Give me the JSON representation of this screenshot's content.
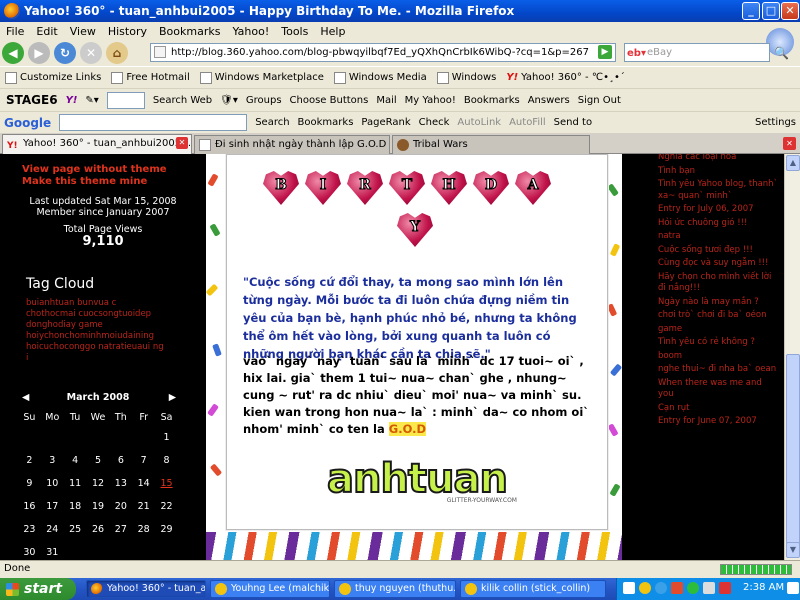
{
  "window": {
    "title": "Yahoo! 360° - tuan_anhbui2005 - Happy Birthday To Me. - Mozilla Firefox"
  },
  "menu": [
    "File",
    "Edit",
    "View",
    "History",
    "Bookmarks",
    "Yahoo!",
    "Tools",
    "Help"
  ],
  "nav": {
    "url": "http://blog.360.yahoo.com/blog-pbwqyilbqf7Ed_yQXhQnCrbIk6WibQ-?cq=1&p=267",
    "search_engine": "eBay",
    "search_placeholder": "eBay"
  },
  "bookmarks_bar": [
    "Customize Links",
    "Free Hotmail",
    "Windows Marketplace",
    "Windows Media",
    "Windows",
    "Yahoo! 360° - ℃•¸•´"
  ],
  "yahoo_toolbar": {
    "stage": "STAGE6",
    "logo": "Y!",
    "items": [
      "Search Web",
      "Groups",
      "Choose Buttons",
      "Mail",
      "My Yahoo!",
      "Bookmarks",
      "Answers",
      "Sign Out"
    ]
  },
  "google_toolbar": {
    "logo": "Google",
    "items": [
      "Search",
      "Bookmarks",
      "PageRank",
      "Check",
      "AutoLink",
      "AutoFill",
      "Send to",
      "Settings"
    ]
  },
  "tabs": [
    {
      "label": "Yahoo! 360° - tuan_anhbui2005 -..."
    },
    {
      "label": "Đi sinh nhật ngày thành lập G.O.D"
    },
    {
      "label": "Tribal Wars"
    }
  ],
  "left": {
    "link1": "View page without theme",
    "link2": "Make this theme mine",
    "last_updated": "Last updated Sat Mar 15, 2008",
    "member_since": "Member since January 2007",
    "views_label": "Total Page Views",
    "views_count": "9,110",
    "tag_cloud_title": "Tag Cloud",
    "tags": [
      "buianhtuan",
      "bunvua",
      "c",
      "chothocmai",
      "cuocsongtuoidep",
      "donghodiay",
      "game",
      "hoiychonchominhmoiudaining",
      "hoicuchoconggo",
      "natratieuaui",
      "ng",
      "i"
    ],
    "calendar": {
      "month": "March 2008",
      "days": [
        "Su",
        "Mo",
        "Tu",
        "We",
        "Th",
        "Fr",
        "Sa"
      ],
      "weeks": [
        [
          "",
          "",
          "",
          "",
          "",
          "",
          "1"
        ],
        [
          "2",
          "3",
          "4",
          "5",
          "6",
          "7",
          "8"
        ],
        [
          "9",
          "10",
          "11",
          "12",
          "13",
          "14",
          "15"
        ],
        [
          "16",
          "17",
          "18",
          "19",
          "20",
          "21",
          "22"
        ],
        [
          "23",
          "24",
          "25",
          "26",
          "27",
          "28",
          "29"
        ],
        [
          "30",
          "31",
          "",
          "",
          "",
          "",
          ""
        ]
      ],
      "highlight": "15"
    }
  },
  "center": {
    "birthday_letters": [
      "B",
      "I",
      "R",
      "T",
      "H",
      "D",
      "A",
      "Y"
    ],
    "quote": "\"Cuộc sống cứ đổi thay, ta mong sao mình lớn lên từng ngày. Mỗi bước ta đi luôn chứa đựng niềm tin yêu của bạn bè, hạnh phúc nhỏ bé, nhưng ta không thể ôm hết vào lòng, bởi xung quanh ta luôn có những người bạn khác cần ta chia sẽ.\"",
    "para": "vao` ngay` nay` tuan` sau la` minh` dc 17 tuoi~ oi` , hix lai. gia` them 1 tui~ nua~ chan` ghe , nhung~ cung ~ rut' ra dc nhiu` dieu` moi' nua~ va minh` su. kien wan trong hon nua~ la` : minh` da~ co nhom oi` nhom' minh` co ten la",
    "god": "G.O.D",
    "signature": "anhtuan",
    "signature_sub": "GLITTER-YOURWAY.COM"
  },
  "right": {
    "items": [
      "Nghĩa các loại hoa",
      "Tình bạn",
      "Tình yêu Yahoo blog, thanh` xa~ quan` minh`",
      "Entry for July 06, 2007",
      "Hỏi ức chuông gió !!!",
      "natra",
      "Cuộc sống tươi đẹp !!!",
      "Cùng đọc và suy ngẫm !!!",
      "Hãy chọn cho mình viết lời đi nắng!!!",
      "Ngày nào là may mắn ?",
      "chơi trò` chơi đi ba` oéon",
      "game",
      "Tình yêu có rẻ không ?",
      "boom",
      "nghe thui~ đi nha ba` oean",
      "When there was me and you",
      "Cạn rụt",
      "Entry for June 07, 2007"
    ]
  },
  "status": "Done",
  "taskbar": {
    "start": "start",
    "buttons": [
      "Yahoo! 360° - tuan_a...",
      "Youhng Lee (malchik_...",
      "thuy nguyen (thuthu...",
      "kilik collin (stick_collin)"
    ],
    "time": "2:38 AM"
  }
}
